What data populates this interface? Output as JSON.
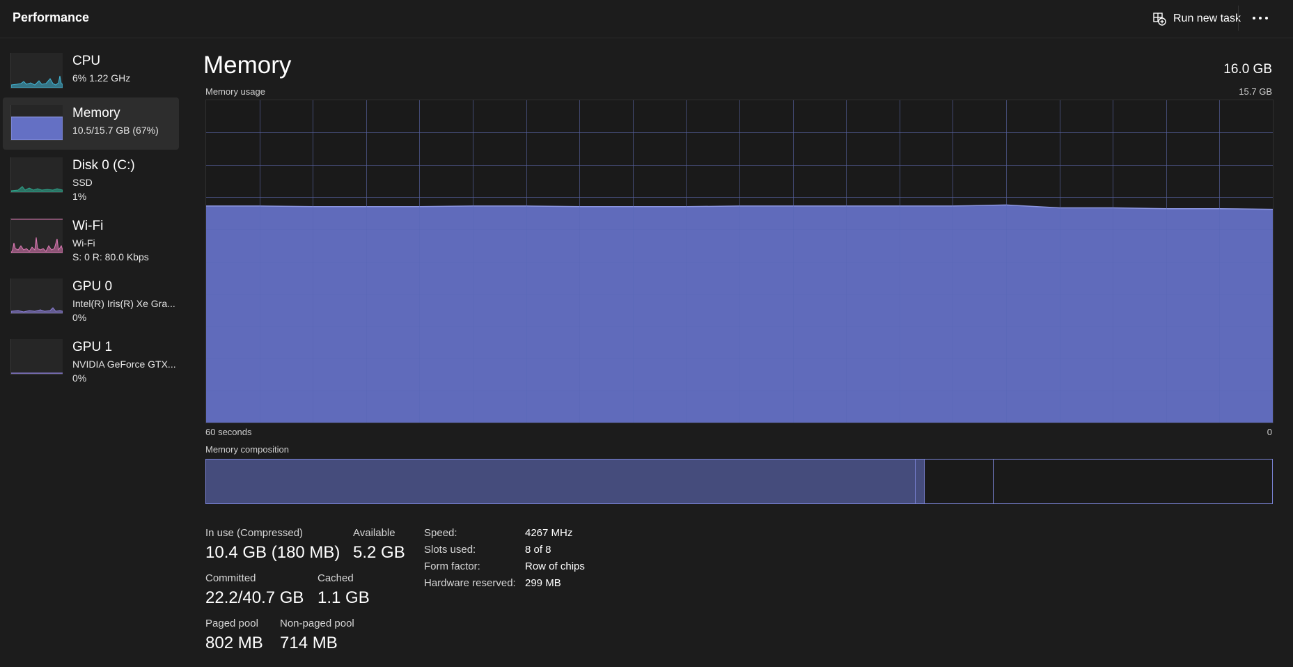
{
  "header": {
    "title": "Performance",
    "run_new_task": "Run new task",
    "more_label": "..."
  },
  "sidebar": {
    "items": [
      {
        "name": "CPU",
        "line1": "6%  1.22 GHz",
        "line2": "",
        "color": "#41b6d6"
      },
      {
        "name": "Memory",
        "line1": "10.5/15.7 GB (67%)",
        "line2": "",
        "color": "#6f7dd4",
        "selected": true
      },
      {
        "name": "Disk 0 (C:)",
        "line1": "SSD",
        "line2": "1%",
        "color": "#2fa58c"
      },
      {
        "name": "Wi-Fi",
        "line1": "Wi-Fi",
        "line2": "S: 0 R: 80.0 Kbps",
        "color": "#e07ab6"
      },
      {
        "name": "GPU 0",
        "line1": "Intel(R) Iris(R) Xe Gra...",
        "line2": "0%",
        "color": "#8c7fd6"
      },
      {
        "name": "GPU 1",
        "line1": "NVIDIA GeForce GTX...",
        "line2": "0%",
        "color": "#8c7fd6"
      }
    ]
  },
  "main": {
    "title": "Memory",
    "total": "16.0 GB",
    "usage_label": "Memory usage",
    "usage_max": "15.7 GB",
    "time_left": "60 seconds",
    "time_right": "0",
    "composition_label": "Memory composition"
  },
  "chart_data": {
    "type": "area",
    "title": "Memory usage",
    "x_label_left": "60 seconds",
    "x_label_right": "0",
    "ylim": [
      0,
      15.7
    ],
    "y_unit": "GB",
    "x": [
      60,
      57,
      54,
      51,
      48,
      45,
      42,
      39,
      36,
      33,
      30,
      27,
      24,
      21,
      18,
      15,
      12,
      9,
      6,
      3,
      0
    ],
    "values": [
      10.55,
      10.55,
      10.52,
      10.52,
      10.52,
      10.55,
      10.55,
      10.52,
      10.52,
      10.52,
      10.55,
      10.55,
      10.55,
      10.55,
      10.55,
      10.6,
      10.46,
      10.46,
      10.42,
      10.42,
      10.39
    ],
    "grid": true,
    "color": "#6470c4"
  },
  "composition": {
    "in_use_fraction": 0.665,
    "modified_fraction": 0.008,
    "standby_fraction": 0.064,
    "free_fraction": 0.263
  },
  "stats": {
    "in_use_label": "In use (Compressed)",
    "in_use_value": "10.4 GB (180 MB)",
    "available_label": "Available",
    "available_value": "5.2 GB",
    "committed_label": "Committed",
    "committed_value": "22.2/40.7 GB",
    "cached_label": "Cached",
    "cached_value": "1.1 GB",
    "paged_label": "Paged pool",
    "paged_value": "802 MB",
    "nonpaged_label": "Non-paged pool",
    "nonpaged_value": "714 MB"
  },
  "properties": {
    "speed_label": "Speed:",
    "speed_value": "4267 MHz",
    "slots_label": "Slots used:",
    "slots_value": "8 of 8",
    "form_label": "Form factor:",
    "form_value": "Row of chips",
    "reserved_label": "Hardware reserved:",
    "reserved_value": "299 MB"
  }
}
